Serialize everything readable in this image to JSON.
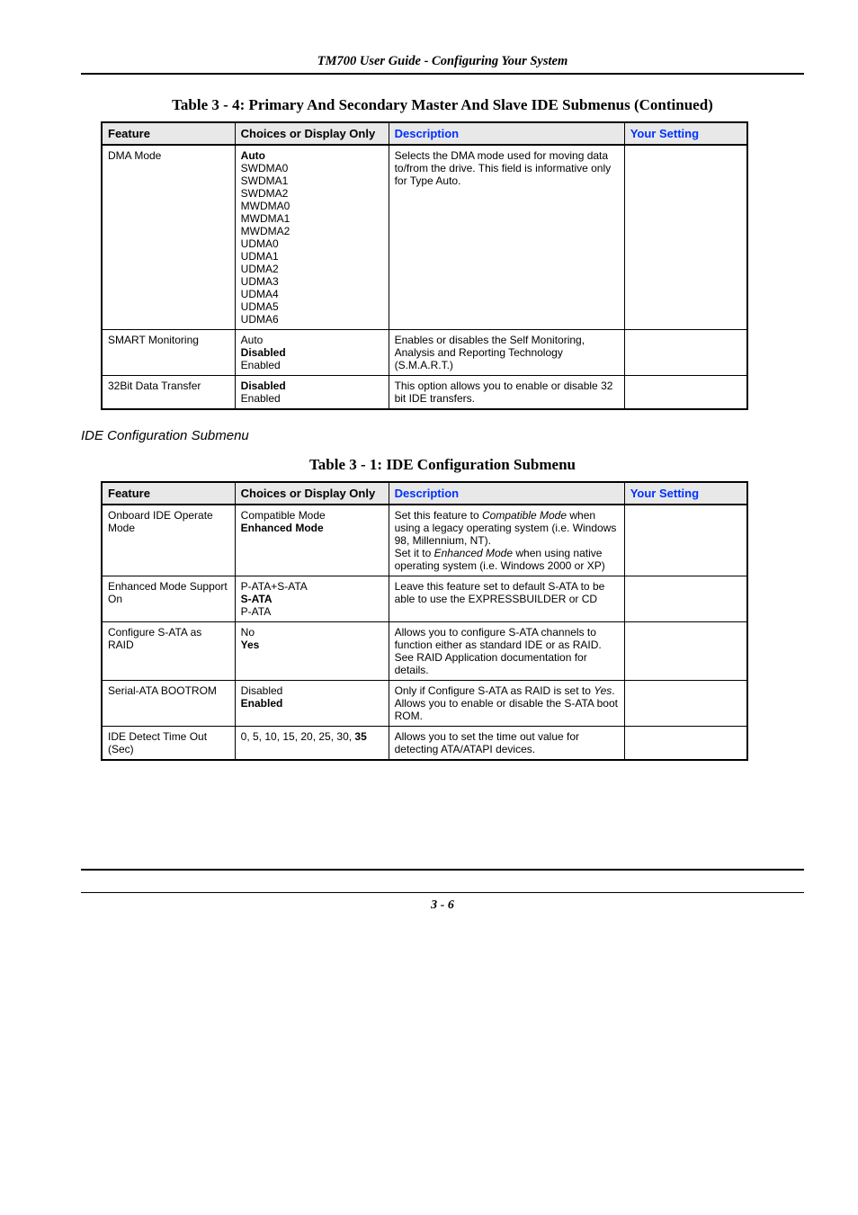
{
  "header": {
    "title": "TM700 User Guide - Configuring Your System"
  },
  "tableA": {
    "caption": "Table 3 - 4: Primary And Secondary Master And Slave IDE Submenus  (Continued)",
    "headers": {
      "feature": "Feature",
      "choices": "Choices or Display Only",
      "description": "Description",
      "setting": "Your Setting"
    },
    "rows": [
      {
        "feature": "DMA Mode",
        "choices_bold": "Auto",
        "choices_rest": [
          "SWDMA0",
          "SWDMA1",
          "SWDMA2",
          "MWDMA0",
          "MWDMA1",
          "MWDMA2",
          "UDMA0",
          "UDMA1",
          "UDMA2",
          "UDMA3",
          "UDMA4",
          "UDMA5",
          "UDMA6"
        ],
        "description": "Selects the DMA mode used for moving data to/from the drive. This field is informative only for Type Auto."
      },
      {
        "feature": "SMART Monitoring",
        "choices_lines": [
          "Auto",
          "Disabled",
          "Enabled"
        ],
        "choices_bold_index": 1,
        "description": "Enables or disables the Self Monitoring, Analysis and Reporting Technology (S.M.A.R.T.)"
      },
      {
        "feature": "32Bit Data Transfer",
        "choices_lines": [
          "Disabled",
          "Enabled"
        ],
        "choices_bold_index": 0,
        "description": "This option allows you to enable or disable 32 bit IDE transfers."
      }
    ]
  },
  "sectionB_title": "IDE Configuration Submenu",
  "tableB": {
    "caption": "Table 3 - 1: IDE Configuration Submenu",
    "headers": {
      "feature": "Feature",
      "choices": "Choices or Display Only",
      "description": "Description",
      "setting": "Your Setting"
    },
    "rows": [
      {
        "feature": "Onboard IDE Operate Mode",
        "choices_lines": [
          "Compatible Mode",
          "Enhanced Mode"
        ],
        "choices_bold_index": 1,
        "desc_parts": [
          {
            "t": "Set this feature to "
          },
          {
            "t": "Compatible Mode",
            "i": true
          },
          {
            "t": " when using a legacy operating system (i.e. Windows 98, Millennium, NT).",
            "br": true
          },
          {
            "t": "Set it to "
          },
          {
            "t": "Enhanced Mode",
            "i": true
          },
          {
            "t": " when using native operating system (i.e. Windows 2000 or XP)"
          }
        ]
      },
      {
        "feature": "Enhanced Mode Support On",
        "choices_lines": [
          "P-ATA+S-ATA",
          "S-ATA",
          "P-ATA"
        ],
        "choices_bold_index": 1,
        "description": "Leave this feature set to default S-ATA to be able to use the EXPRESSBUILDER or CD"
      },
      {
        "feature": "Configure S-ATA as RAID",
        "choices_lines": [
          "No",
          "Yes"
        ],
        "choices_bold_index": 1,
        "description": "Allows you to configure S-ATA channels to function either as standard IDE or as RAID. See RAID Application documentation for details."
      },
      {
        "feature": "Serial-ATA BOOTROM",
        "choices_lines": [
          "Disabled",
          "Enabled"
        ],
        "choices_bold_index": 1,
        "desc_parts": [
          {
            "t": "Only if Configure S-ATA as RAID is set to "
          },
          {
            "t": "Yes",
            "i": true
          },
          {
            "t": ".",
            "br": true
          },
          {
            "t": "Allows you to enable or disable the S-ATA boot ROM."
          }
        ]
      },
      {
        "feature": "IDE Detect Time Out (Sec)",
        "choices_plain": "0, 5, 10, 15, 20, 25, 30, ",
        "choices_bold_tail": "35",
        "description": "Allows you to set the time out value for detecting ATA/ATAPI devices."
      }
    ]
  },
  "footer": {
    "page": "3 - 6"
  },
  "chart_data": {
    "type": "table",
    "tables": [
      {
        "title": "Primary And Secondary Master And Slave IDE Submenus (Continued)",
        "columns": [
          "Feature",
          "Choices or Display Only",
          "Description",
          "Your Setting"
        ],
        "rows": [
          [
            "DMA Mode",
            "Auto / SWDMA0 / SWDMA1 / SWDMA2 / MWDMA0 / MWDMA1 / MWDMA2 / UDMA0 / UDMA1 / UDMA2 / UDMA3 / UDMA4 / UDMA5 / UDMA6",
            "Selects the DMA mode used for moving data to/from the drive. This field is informative only for Type Auto.",
            ""
          ],
          [
            "SMART Monitoring",
            "Auto / Disabled / Enabled",
            "Enables or disables the Self Monitoring, Analysis and Reporting Technology (S.M.A.R.T.)",
            ""
          ],
          [
            "32Bit Data Transfer",
            "Disabled / Enabled",
            "This option allows you to enable or disable 32 bit IDE transfers.",
            ""
          ]
        ]
      },
      {
        "title": "IDE Configuration Submenu",
        "columns": [
          "Feature",
          "Choices or Display Only",
          "Description",
          "Your Setting"
        ],
        "rows": [
          [
            "Onboard IDE Operate Mode",
            "Compatible Mode / Enhanced Mode",
            "Set this feature to Compatible Mode when using a legacy operating system (i.e. Windows 98, Millennium, NT). Set it to Enhanced Mode when using native operating system (i.e. Windows 2000 or XP)",
            ""
          ],
          [
            "Enhanced Mode Support On",
            "P-ATA+S-ATA / S-ATA / P-ATA",
            "Leave this feature set to default S-ATA to be able to use the EXPRESSBUILDER or CD",
            ""
          ],
          [
            "Configure S-ATA as RAID",
            "No / Yes",
            "Allows you to configure S-ATA channels to function either as standard IDE or as RAID. See RAID Application documentation for details.",
            ""
          ],
          [
            "Serial-ATA BOOTROM",
            "Disabled / Enabled",
            "Only if Configure S-ATA as RAID is set to Yes. Allows you to enable or disable the S-ATA boot ROM.",
            ""
          ],
          [
            "IDE Detect Time Out (Sec)",
            "0, 5, 10, 15, 20, 25, 30, 35",
            "Allows you to set the time out value for detecting ATA/ATAPI devices.",
            ""
          ]
        ]
      }
    ]
  }
}
